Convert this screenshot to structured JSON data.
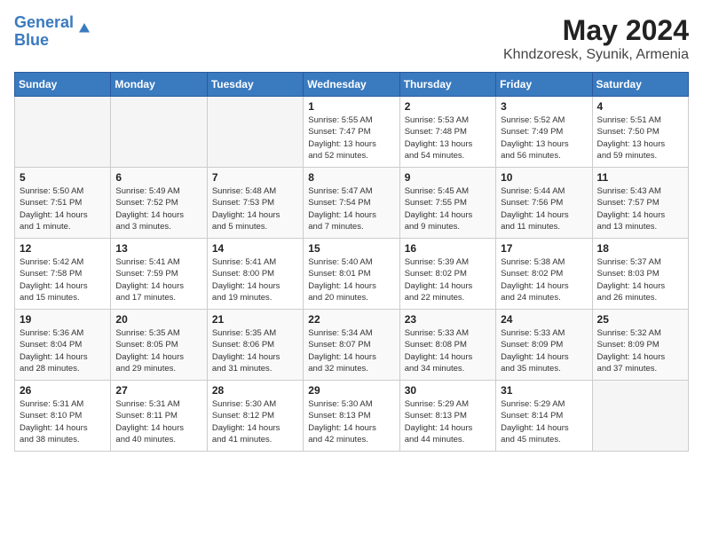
{
  "header": {
    "logo_line1": "General",
    "logo_line2": "Blue",
    "month_year": "May 2024",
    "location": "Khndzoresk, Syunik, Armenia"
  },
  "weekdays": [
    "Sunday",
    "Monday",
    "Tuesday",
    "Wednesday",
    "Thursday",
    "Friday",
    "Saturday"
  ],
  "weeks": [
    [
      {
        "day": "",
        "info": ""
      },
      {
        "day": "",
        "info": ""
      },
      {
        "day": "",
        "info": ""
      },
      {
        "day": "1",
        "info": "Sunrise: 5:55 AM\nSunset: 7:47 PM\nDaylight: 13 hours\nand 52 minutes."
      },
      {
        "day": "2",
        "info": "Sunrise: 5:53 AM\nSunset: 7:48 PM\nDaylight: 13 hours\nand 54 minutes."
      },
      {
        "day": "3",
        "info": "Sunrise: 5:52 AM\nSunset: 7:49 PM\nDaylight: 13 hours\nand 56 minutes."
      },
      {
        "day": "4",
        "info": "Sunrise: 5:51 AM\nSunset: 7:50 PM\nDaylight: 13 hours\nand 59 minutes."
      }
    ],
    [
      {
        "day": "5",
        "info": "Sunrise: 5:50 AM\nSunset: 7:51 PM\nDaylight: 14 hours\nand 1 minute."
      },
      {
        "day": "6",
        "info": "Sunrise: 5:49 AM\nSunset: 7:52 PM\nDaylight: 14 hours\nand 3 minutes."
      },
      {
        "day": "7",
        "info": "Sunrise: 5:48 AM\nSunset: 7:53 PM\nDaylight: 14 hours\nand 5 minutes."
      },
      {
        "day": "8",
        "info": "Sunrise: 5:47 AM\nSunset: 7:54 PM\nDaylight: 14 hours\nand 7 minutes."
      },
      {
        "day": "9",
        "info": "Sunrise: 5:45 AM\nSunset: 7:55 PM\nDaylight: 14 hours\nand 9 minutes."
      },
      {
        "day": "10",
        "info": "Sunrise: 5:44 AM\nSunset: 7:56 PM\nDaylight: 14 hours\nand 11 minutes."
      },
      {
        "day": "11",
        "info": "Sunrise: 5:43 AM\nSunset: 7:57 PM\nDaylight: 14 hours\nand 13 minutes."
      }
    ],
    [
      {
        "day": "12",
        "info": "Sunrise: 5:42 AM\nSunset: 7:58 PM\nDaylight: 14 hours\nand 15 minutes."
      },
      {
        "day": "13",
        "info": "Sunrise: 5:41 AM\nSunset: 7:59 PM\nDaylight: 14 hours\nand 17 minutes."
      },
      {
        "day": "14",
        "info": "Sunrise: 5:41 AM\nSunset: 8:00 PM\nDaylight: 14 hours\nand 19 minutes."
      },
      {
        "day": "15",
        "info": "Sunrise: 5:40 AM\nSunset: 8:01 PM\nDaylight: 14 hours\nand 20 minutes."
      },
      {
        "day": "16",
        "info": "Sunrise: 5:39 AM\nSunset: 8:02 PM\nDaylight: 14 hours\nand 22 minutes."
      },
      {
        "day": "17",
        "info": "Sunrise: 5:38 AM\nSunset: 8:02 PM\nDaylight: 14 hours\nand 24 minutes."
      },
      {
        "day": "18",
        "info": "Sunrise: 5:37 AM\nSunset: 8:03 PM\nDaylight: 14 hours\nand 26 minutes."
      }
    ],
    [
      {
        "day": "19",
        "info": "Sunrise: 5:36 AM\nSunset: 8:04 PM\nDaylight: 14 hours\nand 28 minutes."
      },
      {
        "day": "20",
        "info": "Sunrise: 5:35 AM\nSunset: 8:05 PM\nDaylight: 14 hours\nand 29 minutes."
      },
      {
        "day": "21",
        "info": "Sunrise: 5:35 AM\nSunset: 8:06 PM\nDaylight: 14 hours\nand 31 minutes."
      },
      {
        "day": "22",
        "info": "Sunrise: 5:34 AM\nSunset: 8:07 PM\nDaylight: 14 hours\nand 32 minutes."
      },
      {
        "day": "23",
        "info": "Sunrise: 5:33 AM\nSunset: 8:08 PM\nDaylight: 14 hours\nand 34 minutes."
      },
      {
        "day": "24",
        "info": "Sunrise: 5:33 AM\nSunset: 8:09 PM\nDaylight: 14 hours\nand 35 minutes."
      },
      {
        "day": "25",
        "info": "Sunrise: 5:32 AM\nSunset: 8:09 PM\nDaylight: 14 hours\nand 37 minutes."
      }
    ],
    [
      {
        "day": "26",
        "info": "Sunrise: 5:31 AM\nSunset: 8:10 PM\nDaylight: 14 hours\nand 38 minutes."
      },
      {
        "day": "27",
        "info": "Sunrise: 5:31 AM\nSunset: 8:11 PM\nDaylight: 14 hours\nand 40 minutes."
      },
      {
        "day": "28",
        "info": "Sunrise: 5:30 AM\nSunset: 8:12 PM\nDaylight: 14 hours\nand 41 minutes."
      },
      {
        "day": "29",
        "info": "Sunrise: 5:30 AM\nSunset: 8:13 PM\nDaylight: 14 hours\nand 42 minutes."
      },
      {
        "day": "30",
        "info": "Sunrise: 5:29 AM\nSunset: 8:13 PM\nDaylight: 14 hours\nand 44 minutes."
      },
      {
        "day": "31",
        "info": "Sunrise: 5:29 AM\nSunset: 8:14 PM\nDaylight: 14 hours\nand 45 minutes."
      },
      {
        "day": "",
        "info": ""
      }
    ]
  ]
}
